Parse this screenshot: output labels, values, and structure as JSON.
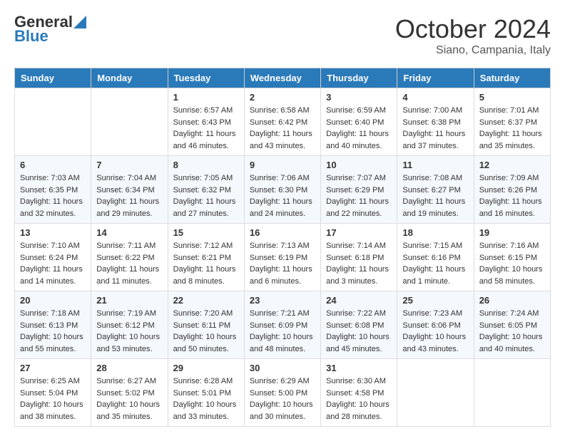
{
  "header": {
    "logo_line1": "General",
    "logo_line2": "Blue",
    "title": "October 2024",
    "subtitle": "Siano, Campania, Italy"
  },
  "days_of_week": [
    "Sunday",
    "Monday",
    "Tuesday",
    "Wednesday",
    "Thursday",
    "Friday",
    "Saturday"
  ],
  "weeks": [
    [
      {
        "day": "",
        "info": ""
      },
      {
        "day": "",
        "info": ""
      },
      {
        "day": "1",
        "info": "Sunrise: 6:57 AM\nSunset: 6:43 PM\nDaylight: 11 hours and 46 minutes."
      },
      {
        "day": "2",
        "info": "Sunrise: 6:58 AM\nSunset: 6:42 PM\nDaylight: 11 hours and 43 minutes."
      },
      {
        "day": "3",
        "info": "Sunrise: 6:59 AM\nSunset: 6:40 PM\nDaylight: 11 hours and 40 minutes."
      },
      {
        "day": "4",
        "info": "Sunrise: 7:00 AM\nSunset: 6:38 PM\nDaylight: 11 hours and 37 minutes."
      },
      {
        "day": "5",
        "info": "Sunrise: 7:01 AM\nSunset: 6:37 PM\nDaylight: 11 hours and 35 minutes."
      }
    ],
    [
      {
        "day": "6",
        "info": "Sunrise: 7:03 AM\nSunset: 6:35 PM\nDaylight: 11 hours and 32 minutes."
      },
      {
        "day": "7",
        "info": "Sunrise: 7:04 AM\nSunset: 6:34 PM\nDaylight: 11 hours and 29 minutes."
      },
      {
        "day": "8",
        "info": "Sunrise: 7:05 AM\nSunset: 6:32 PM\nDaylight: 11 hours and 27 minutes."
      },
      {
        "day": "9",
        "info": "Sunrise: 7:06 AM\nSunset: 6:30 PM\nDaylight: 11 hours and 24 minutes."
      },
      {
        "day": "10",
        "info": "Sunrise: 7:07 AM\nSunset: 6:29 PM\nDaylight: 11 hours and 22 minutes."
      },
      {
        "day": "11",
        "info": "Sunrise: 7:08 AM\nSunset: 6:27 PM\nDaylight: 11 hours and 19 minutes."
      },
      {
        "day": "12",
        "info": "Sunrise: 7:09 AM\nSunset: 6:26 PM\nDaylight: 11 hours and 16 minutes."
      }
    ],
    [
      {
        "day": "13",
        "info": "Sunrise: 7:10 AM\nSunset: 6:24 PM\nDaylight: 11 hours and 14 minutes."
      },
      {
        "day": "14",
        "info": "Sunrise: 7:11 AM\nSunset: 6:22 PM\nDaylight: 11 hours and 11 minutes."
      },
      {
        "day": "15",
        "info": "Sunrise: 7:12 AM\nSunset: 6:21 PM\nDaylight: 11 hours and 8 minutes."
      },
      {
        "day": "16",
        "info": "Sunrise: 7:13 AM\nSunset: 6:19 PM\nDaylight: 11 hours and 6 minutes."
      },
      {
        "day": "17",
        "info": "Sunrise: 7:14 AM\nSunset: 6:18 PM\nDaylight: 11 hours and 3 minutes."
      },
      {
        "day": "18",
        "info": "Sunrise: 7:15 AM\nSunset: 6:16 PM\nDaylight: 11 hours and 1 minute."
      },
      {
        "day": "19",
        "info": "Sunrise: 7:16 AM\nSunset: 6:15 PM\nDaylight: 10 hours and 58 minutes."
      }
    ],
    [
      {
        "day": "20",
        "info": "Sunrise: 7:18 AM\nSunset: 6:13 PM\nDaylight: 10 hours and 55 minutes."
      },
      {
        "day": "21",
        "info": "Sunrise: 7:19 AM\nSunset: 6:12 PM\nDaylight: 10 hours and 53 minutes."
      },
      {
        "day": "22",
        "info": "Sunrise: 7:20 AM\nSunset: 6:11 PM\nDaylight: 10 hours and 50 minutes."
      },
      {
        "day": "23",
        "info": "Sunrise: 7:21 AM\nSunset: 6:09 PM\nDaylight: 10 hours and 48 minutes."
      },
      {
        "day": "24",
        "info": "Sunrise: 7:22 AM\nSunset: 6:08 PM\nDaylight: 10 hours and 45 minutes."
      },
      {
        "day": "25",
        "info": "Sunrise: 7:23 AM\nSunset: 6:06 PM\nDaylight: 10 hours and 43 minutes."
      },
      {
        "day": "26",
        "info": "Sunrise: 7:24 AM\nSunset: 6:05 PM\nDaylight: 10 hours and 40 minutes."
      }
    ],
    [
      {
        "day": "27",
        "info": "Sunrise: 6:25 AM\nSunset: 5:04 PM\nDaylight: 10 hours and 38 minutes."
      },
      {
        "day": "28",
        "info": "Sunrise: 6:27 AM\nSunset: 5:02 PM\nDaylight: 10 hours and 35 minutes."
      },
      {
        "day": "29",
        "info": "Sunrise: 6:28 AM\nSunset: 5:01 PM\nDaylight: 10 hours and 33 minutes."
      },
      {
        "day": "30",
        "info": "Sunrise: 6:29 AM\nSunset: 5:00 PM\nDaylight: 10 hours and 30 minutes."
      },
      {
        "day": "31",
        "info": "Sunrise: 6:30 AM\nSunset: 4:58 PM\nDaylight: 10 hours and 28 minutes."
      },
      {
        "day": "",
        "info": ""
      },
      {
        "day": "",
        "info": ""
      }
    ]
  ]
}
